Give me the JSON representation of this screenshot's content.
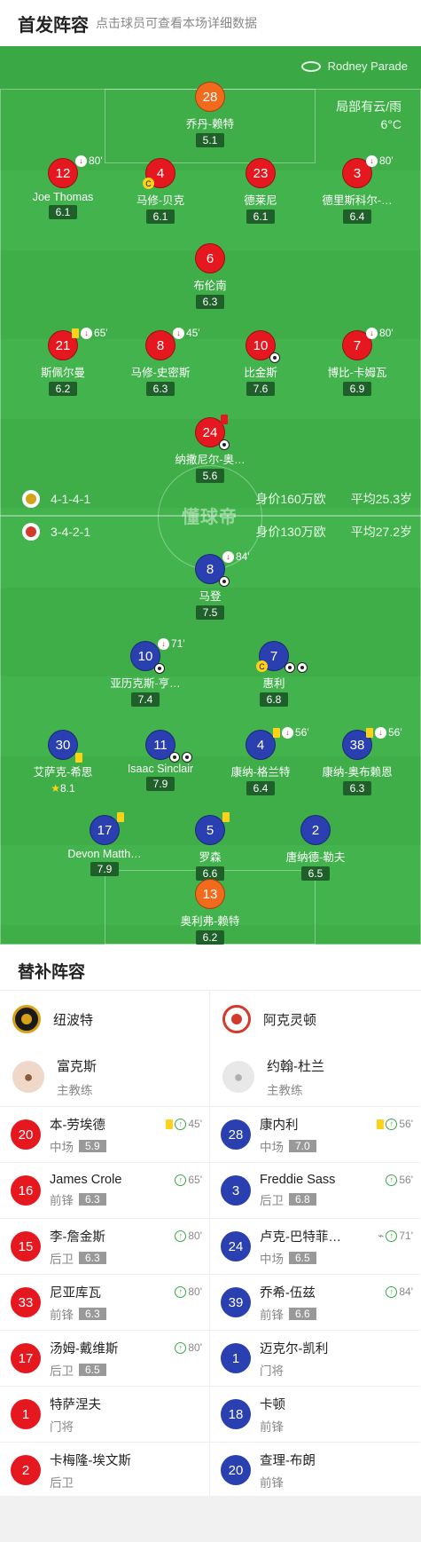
{
  "header": {
    "title": "首发阵容",
    "subtitle": "点击球员可查看本场详细数据"
  },
  "pitch": {
    "venue": "Rodney Parade",
    "weather": "局部有云/雨",
    "temperature": "6°C",
    "watermark": "懂球帝",
    "home_formation": "4-1-4-1",
    "home_value": "身价160万欧",
    "home_age": "平均25.3岁",
    "away_formation": "3-4-2-1",
    "away_value": "身价130万欧",
    "away_age": "平均27.2岁"
  },
  "home_players": [
    {
      "num": "28",
      "name": "乔丹-赖特",
      "rating": "5.1",
      "color": "orange"
    },
    {
      "num": "12",
      "name": "Joe Thomas",
      "rating": "6.1",
      "color": "red",
      "sub_out": "80'"
    },
    {
      "num": "4",
      "name": "马修-贝克",
      "rating": "6.1",
      "color": "red",
      "captain": "C"
    },
    {
      "num": "23",
      "name": "德莱尼",
      "rating": "6.1",
      "color": "red"
    },
    {
      "num": "3",
      "name": "德里斯科尔-…",
      "rating": "6.4",
      "color": "red",
      "sub_out": "80'"
    },
    {
      "num": "6",
      "name": "布伦南",
      "rating": "6.3",
      "color": "red"
    },
    {
      "num": "21",
      "name": "斯佩尔曼",
      "rating": "6.2",
      "color": "red",
      "sub_out": "65'"
    },
    {
      "num": "8",
      "name": "马修-史密斯",
      "rating": "6.3",
      "color": "red",
      "sub_out": "45'"
    },
    {
      "num": "10",
      "name": "比金斯",
      "rating": "7.6",
      "color": "red"
    },
    {
      "num": "7",
      "name": "博比-卡姆瓦",
      "rating": "6.9",
      "color": "red",
      "sub_out": "80'"
    },
    {
      "num": "24",
      "name": "纳撒尼尔-奥…",
      "rating": "5.6",
      "color": "red"
    }
  ],
  "away_players": [
    {
      "num": "8",
      "name": "马登",
      "rating": "7.5",
      "color": "blue",
      "sub_out": "84'"
    },
    {
      "num": "10",
      "name": "亚历克斯-亨…",
      "rating": "7.4",
      "color": "blue",
      "sub_out": "71'"
    },
    {
      "num": "7",
      "name": "惠利",
      "rating": "6.8",
      "color": "blue",
      "captain": "C"
    },
    {
      "num": "30",
      "name": "艾萨克-希思",
      "rating": "8.1",
      "color": "blue"
    },
    {
      "num": "11",
      "name": "Isaac Sinclair",
      "rating": "7.9",
      "color": "blue"
    },
    {
      "num": "4",
      "name": "康纳-格兰特",
      "rating": "6.4",
      "color": "blue",
      "sub_out": "56'"
    },
    {
      "num": "38",
      "name": "康纳-奥布赖恩",
      "rating": "6.3",
      "color": "blue",
      "sub_out": "56'"
    },
    {
      "num": "17",
      "name": "Devon Matth…",
      "rating": "7.9",
      "color": "blue"
    },
    {
      "num": "5",
      "name": "罗森",
      "rating": "6.6",
      "color": "blue"
    },
    {
      "num": "2",
      "name": "唐纳德-勒夫",
      "rating": "6.5",
      "color": "blue"
    },
    {
      "num": "13",
      "name": "奥利弗-赖特",
      "rating": "6.2",
      "color": "orange"
    }
  ],
  "subs": {
    "title": "替补阵容",
    "home": {
      "team": "纽波特",
      "coach": {
        "name": "富克斯",
        "role": "主教练"
      },
      "players": [
        {
          "num": "20",
          "name": "本-劳埃德",
          "pos": "中场",
          "rating": "5.9",
          "time": "45'",
          "yellow": true
        },
        {
          "num": "16",
          "name": "James Crole",
          "pos": "前锋",
          "rating": "6.3",
          "time": "65'"
        },
        {
          "num": "15",
          "name": "李-詹金斯",
          "pos": "后卫",
          "rating": "6.3",
          "time": "80'"
        },
        {
          "num": "33",
          "name": "尼亚库瓦",
          "pos": "前锋",
          "rating": "6.3",
          "time": "80'"
        },
        {
          "num": "17",
          "name": "汤姆-戴维斯",
          "pos": "后卫",
          "rating": "6.5",
          "time": "80'"
        },
        {
          "num": "1",
          "name": "特萨涅夫",
          "pos": "门将"
        },
        {
          "num": "2",
          "name": "卡梅隆-埃文斯",
          "pos": "后卫"
        }
      ]
    },
    "away": {
      "team": "阿克灵顿",
      "coach": {
        "name": "约翰-杜兰",
        "role": "主教练"
      },
      "players": [
        {
          "num": "28",
          "name": "康内利",
          "pos": "中场",
          "rating": "7.0",
          "time": "56'",
          "yellow": true
        },
        {
          "num": "3",
          "name": "Freddie Sass",
          "pos": "后卫",
          "rating": "6.8",
          "time": "56'"
        },
        {
          "num": "24",
          "name": "卢克-巴特菲…",
          "pos": "中场",
          "rating": "6.5",
          "time": "71'"
        },
        {
          "num": "39",
          "name": "乔希-伍兹",
          "pos": "前锋",
          "rating": "6.6",
          "time": "84'"
        },
        {
          "num": "1",
          "name": "迈克尔-凯利",
          "pos": "门将"
        },
        {
          "num": "18",
          "name": "卡顿",
          "pos": "前锋"
        },
        {
          "num": "20",
          "name": "查理-布朗",
          "pos": "前锋"
        }
      ]
    }
  }
}
